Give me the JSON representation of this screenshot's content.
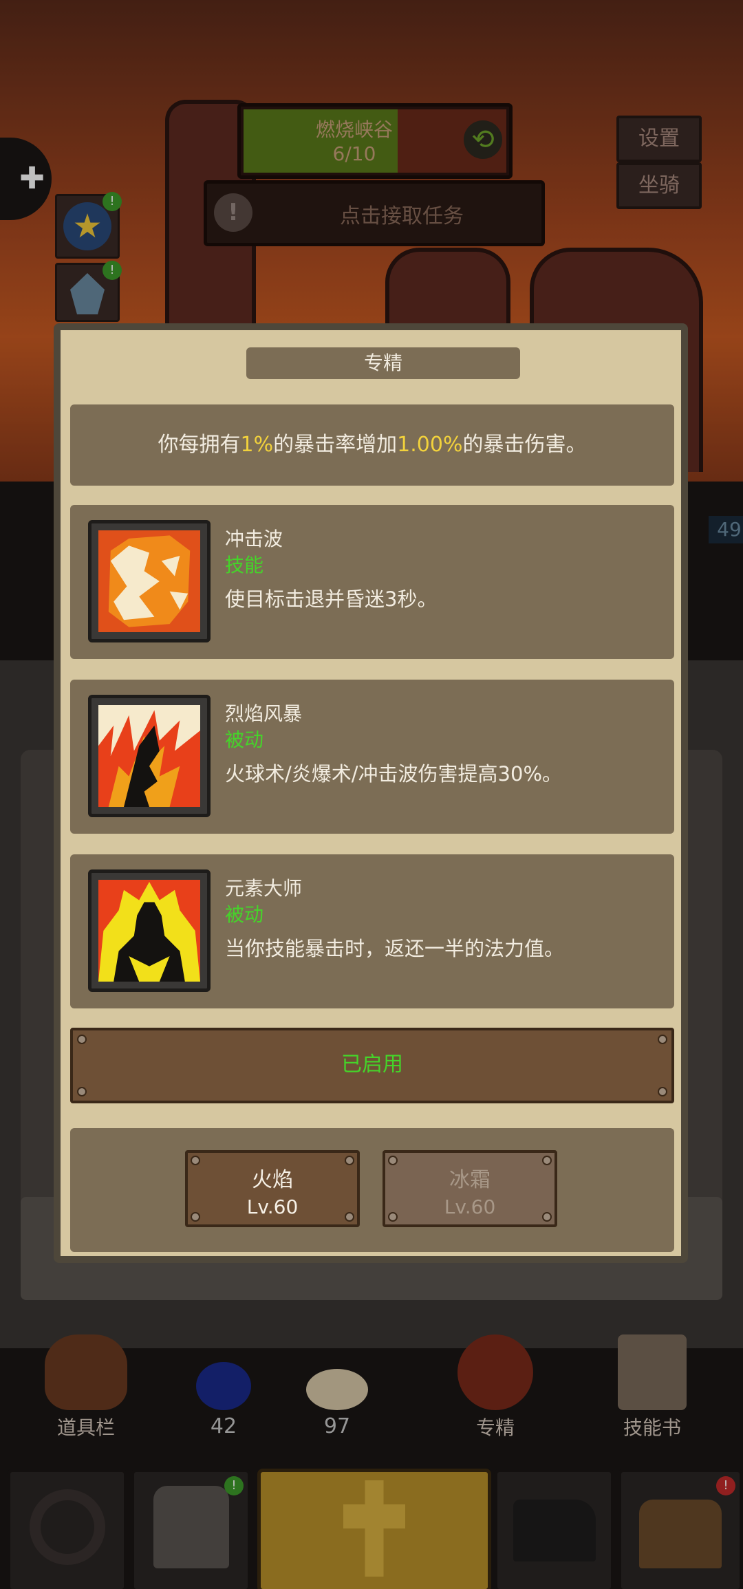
{
  "hud": {
    "map_name": "燃烧峡谷",
    "map_progress": "6/10",
    "map_progress_fraction": 0.6,
    "quest_prompt": "点击接取任务",
    "settings_label": "设置",
    "mount_label": "坐骑",
    "side_value": "49"
  },
  "toolbar": {
    "inventory_label": "道具栏",
    "potion_count": "42",
    "food_count": "97",
    "specialization_label": "专精",
    "skill_book_label": "技能书"
  },
  "modal": {
    "title": "专精",
    "desc_part1": "你每拥有",
    "desc_value1": "1%",
    "desc_part2": "的暴击率增加",
    "desc_value2": "1.00%",
    "desc_part3": "的暴击伤害。",
    "skills": [
      {
        "name": "冲击波",
        "type": "技能",
        "text": "使目标击退并昏迷3秒。"
      },
      {
        "name": "烈焰风暴",
        "type": "被动",
        "text": "火球术/炎爆术/冲击波伤害提高30%。"
      },
      {
        "name": "元素大师",
        "type": "被动",
        "text": "当你技能暴击时，返还一半的法力值。"
      }
    ],
    "enabled_label": "已启用",
    "specs": [
      {
        "name": "火焰",
        "level": "Lv.60"
      },
      {
        "name": "冰霜",
        "level": "Lv.60"
      }
    ]
  },
  "colors": {
    "accent_green": "#45d42a",
    "highlight_yellow": "#f2d23c",
    "panel_bg": "#d6c7a0",
    "card_bg": "#7c6d55"
  }
}
